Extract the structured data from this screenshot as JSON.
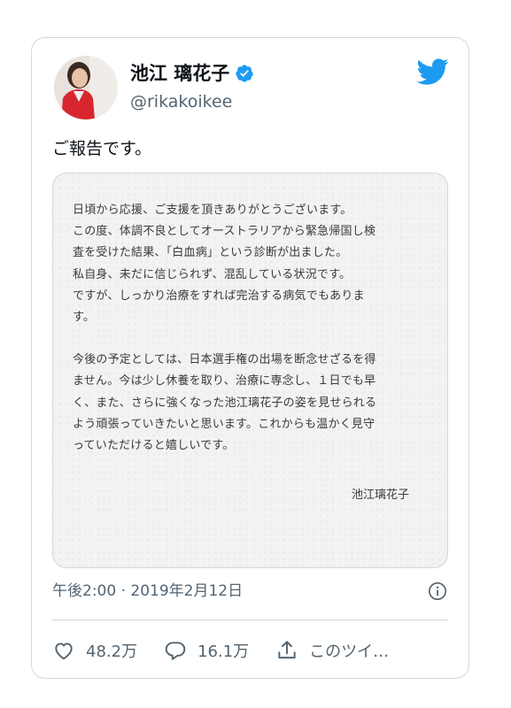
{
  "author": {
    "display_name": "池江 璃花子",
    "handle": "@rikakoikee",
    "verified": true
  },
  "tweet": {
    "text": "ご報告です。",
    "timestamp": "午後2:00 · 2019年2月12日"
  },
  "media_letter": {
    "paragraph_1": "日頃から応援、ご支援を頂きありがとうございます。\nこの度、体調不良としてオーストラリアから緊急帰国し検\n査を受けた結果、「白血病」という診断が出ました。\n私自身、未だに信じられず、混乱している状況です。\nですが、しっかり治療をすれば完治する病気でもありま\nす。",
    "paragraph_2": "今後の予定としては、日本選手権の出場を断念せざるを得\nません。今は少し休養を取り、治療に専念し、１日でも早\nく、また、さらに強くなった池江璃花子の姿を見せられる\nよう頑張っていきたいと思います。これからも温かく見守\nっていただけると嬉しいです。",
    "signature": "池江璃花子"
  },
  "actions": {
    "like_count": "48.2万",
    "reply_count": "16.1万",
    "share_label": "このツイ…"
  },
  "colors": {
    "brand_blue": "#1d9bf0",
    "secondary_text": "#536471",
    "border": "#cfd9de"
  },
  "icons": [
    "twitter-bird-icon",
    "verified-badge-icon",
    "info-icon",
    "heart-icon",
    "reply-bubble-icon",
    "share-icon"
  ]
}
